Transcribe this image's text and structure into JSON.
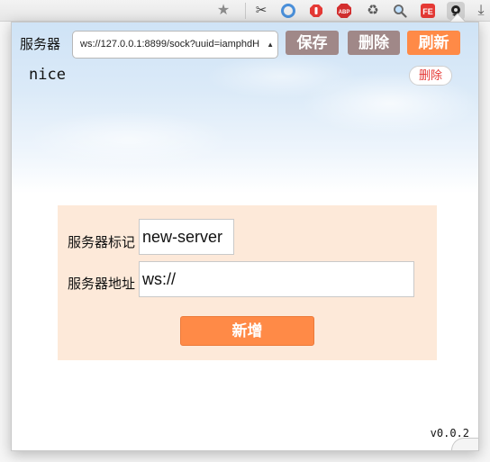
{
  "browser": {
    "toolbar_icons": [
      {
        "name": "bookmark-star-icon",
        "glyph": "★",
        "color": "#8a8a8a"
      },
      {
        "name": "cut-icon",
        "glyph": "✂",
        "color": "#444444"
      },
      {
        "name": "circle-extension-icon",
        "glyph": "◎",
        "color": "#4a8fd9"
      },
      {
        "name": "stop-extension-icon",
        "glyph": "✋",
        "color": "#e53935"
      },
      {
        "name": "abp-icon",
        "glyph": "ABP",
        "color": "#d32f2f"
      },
      {
        "name": "recycle-icon",
        "glyph": "♻",
        "color": "#5a5a5a"
      },
      {
        "name": "magnifier-icon",
        "glyph": "🔍",
        "color": "#555555"
      },
      {
        "name": "fe-icon",
        "glyph": "FE",
        "color": "#e53935"
      },
      {
        "name": "active-extension-icon",
        "glyph": "⬤",
        "color": "#222222"
      },
      {
        "name": "download-icon",
        "glyph": "⤓",
        "color": "#555555"
      }
    ]
  },
  "header": {
    "server_label": "服务器",
    "server_select_value": "ws://127.0.0.1:8899/sock?uuid=iamphdH",
    "save_label": "保存",
    "delete_label": "删除",
    "refresh_label": "刷新"
  },
  "current": {
    "name": "nice",
    "delete_label": "删除"
  },
  "form": {
    "name_label": "服务器标记",
    "name_value": "new-server",
    "address_label": "服务器地址",
    "address_value": "ws://",
    "add_label": "新增"
  },
  "footer": {
    "version": "v0.0.2"
  },
  "colors": {
    "accent": "#ff8a47",
    "muted_button": "#a08888",
    "form_background": "#fde9d9",
    "danger_text": "#e53935"
  }
}
